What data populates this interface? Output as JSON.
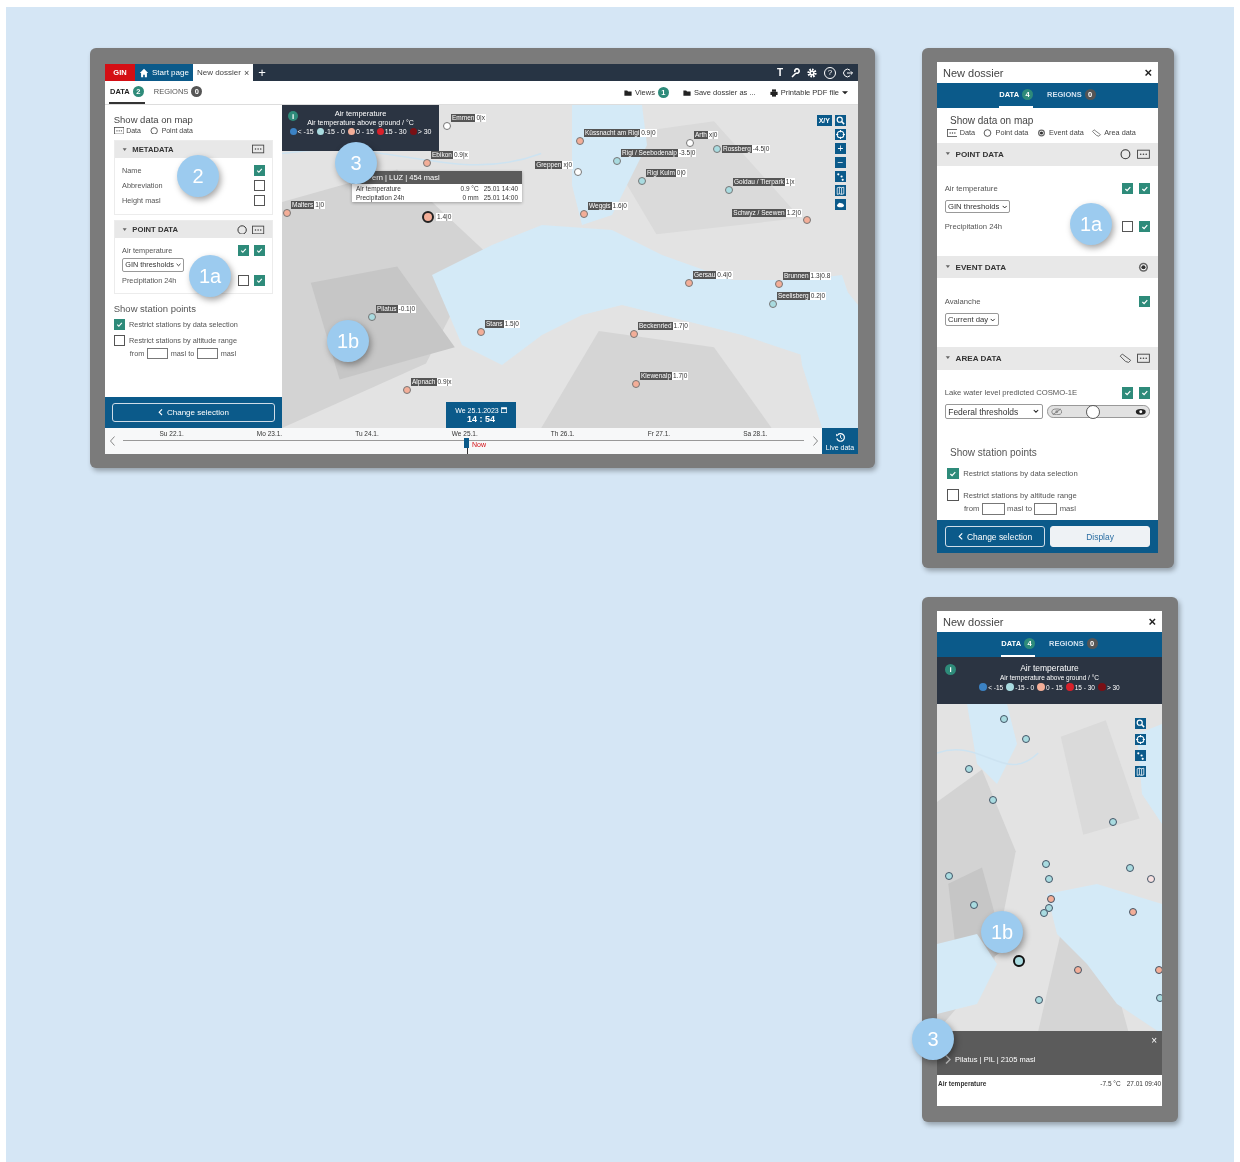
{
  "desktop": {
    "topbar": {
      "logo": "GIN",
      "tabs": [
        {
          "kind": "home",
          "label": "Start page",
          "selected": false
        },
        {
          "kind": "dossier",
          "label": "New dossier",
          "close": "×",
          "selected": true
        }
      ],
      "add": "+",
      "text_tool": "T",
      "help": "?"
    },
    "panel_tabs": [
      {
        "label": "DATA",
        "count": "2",
        "selected": true
      },
      {
        "label": "REGIONS",
        "count": "0",
        "selected": false
      }
    ],
    "toolbar": [
      {
        "kind": "folder",
        "label": "Views",
        "badge": "1"
      },
      {
        "kind": "folder",
        "label": "Save dossier as ..."
      },
      {
        "kind": "print",
        "label": "Printable PDF file"
      }
    ],
    "sidebar": {
      "title": "Show data on map",
      "legend": [
        {
          "kind": "data",
          "label": "Data"
        },
        {
          "kind": "point",
          "label": "Point data"
        }
      ],
      "sections": [
        {
          "title": "METADATA",
          "icons": [
            {
              "kind": "data"
            }
          ],
          "rows": [
            {
              "label": "Name",
              "checks": [
                true
              ]
            },
            {
              "label": "Abbreviation",
              "checks": [
                false
              ]
            },
            {
              "label": "Height masl",
              "checks": [
                false
              ]
            }
          ]
        },
        {
          "title": "POINT DATA",
          "icons": [
            {
              "kind": "point"
            },
            {
              "kind": "data"
            }
          ],
          "rows": [
            {
              "label": "Air temperature",
              "checks": [
                true,
                true
              ],
              "select": "GIN thresholds"
            },
            {
              "label": "Precipitation 24h",
              "checks": [
                false,
                true
              ]
            }
          ]
        }
      ],
      "station_points": {
        "title": "Show station points",
        "options": [
          {
            "label": "Restrict stations by data selection",
            "checked": true
          },
          {
            "label": "Restrict stations by altitude range",
            "checked": false
          }
        ],
        "from": "from",
        "from_unit": "masl",
        "to": "to",
        "to_unit": "masl"
      },
      "buttons": [
        {
          "kind": "back",
          "label": "Change selection"
        }
      ]
    },
    "legend": {
      "info": "i",
      "title": "Air temperature",
      "subtitle": "Air temperature above ground / °C",
      "classes": [
        {
          "label": "< -15",
          "color": "#3b82c4"
        },
        {
          "label": "-15 - 0",
          "color": "#a9dbe0"
        },
        {
          "label": "0 - 15",
          "color": "#f3ae98"
        },
        {
          "label": "15 - 30",
          "color": "#d8202a"
        },
        {
          "label": "> 30",
          "color": "#7a1015"
        }
      ]
    },
    "map_xy": "X/Y",
    "map_controls": [
      {
        "kind": "search"
      },
      {
        "kind": "target"
      },
      {
        "kind": "zoom",
        "label": "+"
      },
      {
        "kind": "zoom",
        "label": "−"
      },
      {
        "kind": "points"
      },
      {
        "kind": "map"
      },
      {
        "kind": "cloud"
      }
    ],
    "stations": [
      {
        "name": "Emmen",
        "value": "0|x",
        "color": "#ffffff",
        "selected": false
      },
      {
        "name": "Ebikon",
        "value": "0.9|x",
        "color": "#f3ae98",
        "selected": false
      },
      {
        "name": "Küssnacht am Rigi",
        "value": "0.9|0",
        "color": "#f3ae98",
        "selected": false
      },
      {
        "name": "Greppen",
        "value": "x|0",
        "color": "#ffffff",
        "selected": false
      },
      {
        "name": "Rigi / Seebodenalp",
        "value": "-3.5|0",
        "color": "#a9dbe0",
        "selected": false
      },
      {
        "name": "Rigi Kulm",
        "value": "0|0",
        "color": "#a9dbe0",
        "selected": false
      },
      {
        "name": "Arth",
        "value": "x|0",
        "color": "#ffffff",
        "selected": false
      },
      {
        "name": "Rossberg",
        "value": "-4.5|0",
        "color": "#a9dbe0",
        "selected": false
      },
      {
        "name": "Goldau / Tierpark",
        "value": "1|x",
        "color": "#a9dbe0",
        "selected": false
      },
      {
        "name": "Malters",
        "value": "1|0",
        "color": "#f3ae98",
        "selected": false
      },
      {
        "value": "1.4|0",
        "color": "#f3ae98",
        "selected": true
      },
      {
        "name": "Weggis",
        "value": "1.6|0",
        "color": "#f3ae98",
        "selected": false
      },
      {
        "name": "Schwyz / Seewen",
        "value": "1.2|0",
        "color": "#f3ae98",
        "selected": false
      },
      {
        "name": "Gersau",
        "value": "0.4|0",
        "color": "#f3ae98",
        "selected": false
      },
      {
        "name": "Brunnen",
        "value": "1.3|0.8",
        "color": "#f3ae98",
        "selected": false
      },
      {
        "name": "Seelisberg",
        "value": "0.2|0",
        "color": "#a9dbe0",
        "selected": false
      },
      {
        "name": "Pilatus",
        "value": "-0.1|0",
        "color": "#a9dbe0",
        "selected": false
      },
      {
        "name": "Stans",
        "value": "1.5|0",
        "color": "#f3ae98",
        "selected": false
      },
      {
        "name": "Beckenried",
        "value": "1.7|0",
        "color": "#f3ae98",
        "selected": false
      },
      {
        "name": "Alpnach",
        "value": "0.9|x",
        "color": "#f3ae98",
        "selected": false
      },
      {
        "name": "Klewenalp",
        "value": "1.7|0",
        "color": "#f3ae98",
        "selected": false
      }
    ],
    "popup": {
      "title": "ern | LUZ | 454 masl",
      "rows": [
        {
          "label": "Air temperature",
          "value": "0.9 °C",
          "time": "25.01 14:40"
        },
        {
          "label": "Precipitation 24h",
          "value": "0 mm",
          "time": "25.01 14:00"
        }
      ]
    },
    "timeline": {
      "date": "We 25.1.2023",
      "time": "14 : 54",
      "now": "Now",
      "level": 0.505,
      "days": [
        "Su 22.1.",
        "Mo 23.1.",
        "Tu 24.1.",
        "We 25.1.",
        "Th 26.1.",
        "Fr 27.1.",
        "Sa 28.1."
      ],
      "live": "Live data"
    },
    "callouts": [
      "2",
      "1a",
      "3",
      "1b"
    ]
  },
  "tablet": {
    "title": "New dossier",
    "close": "×",
    "tabs": [
      {
        "label": "DATA",
        "count": "4",
        "selected": true
      },
      {
        "label": "REGIONS",
        "count": "0",
        "selected": false
      }
    ],
    "panel": {
      "title": "Show data on map",
      "legend": [
        {
          "kind": "data",
          "label": "Data"
        },
        {
          "kind": "point",
          "label": "Point data"
        },
        {
          "kind": "event",
          "label": "Event data"
        },
        {
          "kind": "area",
          "label": "Area data"
        }
      ],
      "sections": [
        {
          "title": "POINT DATA",
          "icons": [
            {
              "kind": "point"
            },
            {
              "kind": "data"
            }
          ],
          "rows": [
            {
              "label": "Air temperature",
              "checks": [
                true,
                true
              ],
              "select": "GIN thresholds"
            },
            {
              "label": "Precipitation 24h",
              "checks": [
                false,
                true
              ]
            }
          ]
        },
        {
          "title": "EVENT DATA",
          "icons": [
            {
              "kind": "event"
            }
          ],
          "rows": [
            {
              "label": "Avalanche",
              "checks": [
                true
              ],
              "select": "Current day"
            }
          ]
        },
        {
          "title": "AREA DATA",
          "icons": [
            {
              "kind": "area"
            },
            {
              "kind": "data"
            }
          ],
          "rows": [
            {
              "label": "Lake water level predicted COSMO-1E",
              "checks": [
                true,
                true
              ],
              "select": "Federal thresholds",
              "level": 0.45
            }
          ]
        }
      ],
      "station_points": {
        "title": "Show station points",
        "options": [
          {
            "label": "Restrict stations by data selection",
            "checked": true
          },
          {
            "label": "Restrict stations by altitude range",
            "checked": false
          }
        ],
        "from": "from",
        "from_unit": "masl",
        "to": "to",
        "to_unit": "masl"
      },
      "buttons": [
        {
          "kind": "back",
          "label": "Change selection"
        },
        {
          "kind": "primary",
          "label": "Display"
        }
      ]
    },
    "callouts": [
      "1a"
    ]
  },
  "phone": {
    "title": "New dossier",
    "close": "×",
    "tabs": [
      {
        "label": "DATA",
        "count": "4",
        "selected": true
      },
      {
        "label": "REGIONS",
        "count": "0",
        "selected": false
      }
    ],
    "legend": {
      "info": "i",
      "title": "Air temperature",
      "subtitle": "Air temperature above ground / °C",
      "classes": [
        {
          "label": "< -15",
          "color": "#3b82c4"
        },
        {
          "label": "-15 - 0",
          "color": "#a9dbe0"
        },
        {
          "label": "0 - 15",
          "color": "#f3ae98"
        },
        {
          "label": "15 - 30",
          "color": "#d8202a"
        },
        {
          "label": "> 30",
          "color": "#7a1015"
        }
      ]
    },
    "map_controls": [
      {
        "kind": "search"
      },
      {
        "kind": "target"
      },
      {
        "kind": "points"
      },
      {
        "kind": "map"
      }
    ],
    "stations": [
      {
        "color": "#a9dbe0",
        "selected": false
      },
      {
        "color": "#a9dbe0",
        "selected": false
      },
      {
        "color": "#a9dbe0",
        "selected": false
      },
      {
        "color": "#a9dbe0",
        "selected": false
      },
      {
        "color": "#a9dbe0",
        "selected": false
      },
      {
        "color": "#a9dbe0",
        "selected": false
      },
      {
        "color": "#a9dbe0",
        "selected": false
      },
      {
        "color": "#a9dbe0",
        "selected": false
      },
      {
        "color": "#a9dbe0",
        "selected": false
      },
      {
        "color": "#f3ae98",
        "selected": false
      },
      {
        "color": "#a9dbe0",
        "selected": false
      },
      {
        "color": "#a9dbe0",
        "selected": false
      },
      {
        "color": "#a9dbe0",
        "selected": false
      },
      {
        "color": "#f7e0e0",
        "selected": false
      },
      {
        "color": "#f3ae98",
        "selected": false
      },
      {
        "color": "#a9dbe0",
        "selected": true
      },
      {
        "color": "#f3ae98",
        "selected": false
      },
      {
        "color": "#a9dbe0",
        "selected": false
      },
      {
        "color": "#f3ae98",
        "selected": false
      },
      {
        "color": "#a9dbe0",
        "selected": false
      }
    ],
    "popup": {
      "title": "Pilatus | PIL | 2105 masl",
      "close": "×",
      "rows": [
        {
          "label": "Air temperature",
          "value": "-7.5 °C",
          "time": "27.01 09:40"
        }
      ]
    },
    "callouts": [
      "1b",
      "3"
    ]
  }
}
